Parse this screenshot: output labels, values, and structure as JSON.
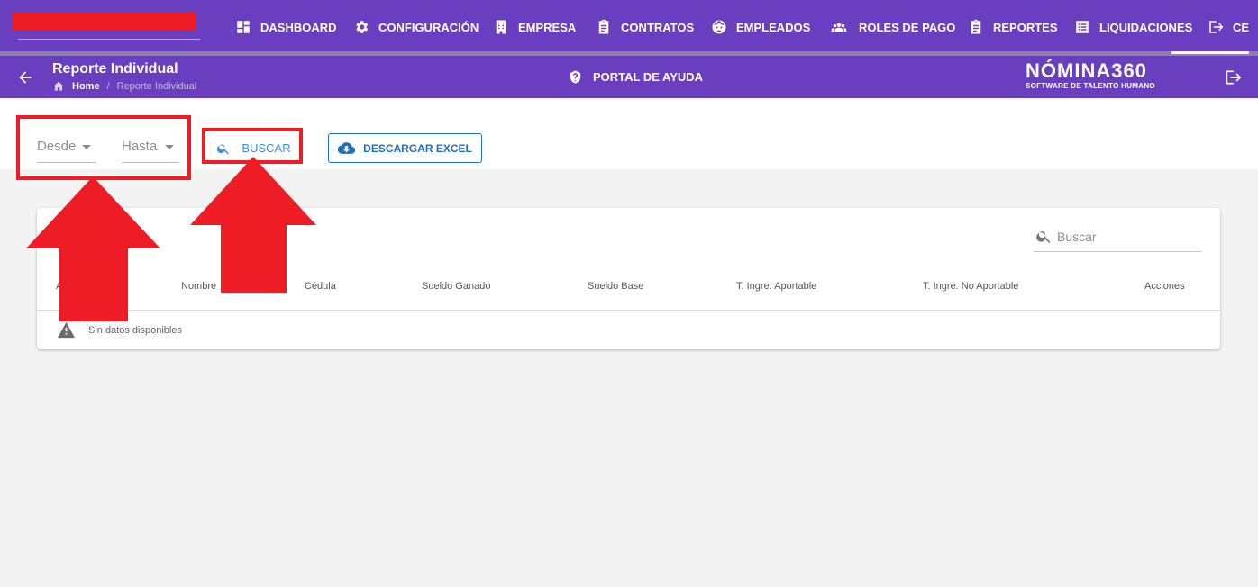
{
  "nav": {
    "items": [
      {
        "label": "DASHBOARD",
        "icon": "dashboard-icon"
      },
      {
        "label": "CONFIGURACIÓN",
        "icon": "gear-icon"
      },
      {
        "label": "EMPRESA",
        "icon": "building-icon"
      },
      {
        "label": "CONTRATOS",
        "icon": "clipboard-icon"
      },
      {
        "label": "EMPLEADOS",
        "icon": "face-icon"
      },
      {
        "label": "ROLES DE PAGO",
        "icon": "group-icon"
      },
      {
        "label": "REPORTES",
        "icon": "clipboard-icon"
      },
      {
        "label": "LIQUIDACIONES",
        "icon": "list-icon"
      },
      {
        "label": "CE",
        "icon": "logout-icon"
      }
    ]
  },
  "header": {
    "title": "Reporte Individual",
    "breadcrumb": {
      "home": "Home",
      "separator": "/",
      "current": "Reporte Individual"
    },
    "help_label": "PORTAL DE AYUDA",
    "logo_main": "NÓMINA360",
    "logo_sub": "SOFTWARE DE TALENTO HUMANO"
  },
  "filters": {
    "desde": "Desde",
    "hasta": "Hasta",
    "search_button": "BUSCAR",
    "excel_button": "DESCARGAR EXCEL"
  },
  "table": {
    "search_placeholder": "Buscar",
    "columns": [
      "A",
      "Nombre",
      "Cédula",
      "Sueldo Ganado",
      "Sueldo Base",
      "T. Ingre. Aportable",
      "T. Ingre. No Aportable",
      "Acciones"
    ],
    "empty_message": "Sin datos disponibles"
  },
  "colors": {
    "primary": "#6a3fbf",
    "accent_blue": "#1f6fc5",
    "annotation_red": "#ee1c25",
    "background": "#f3f3f3"
  }
}
